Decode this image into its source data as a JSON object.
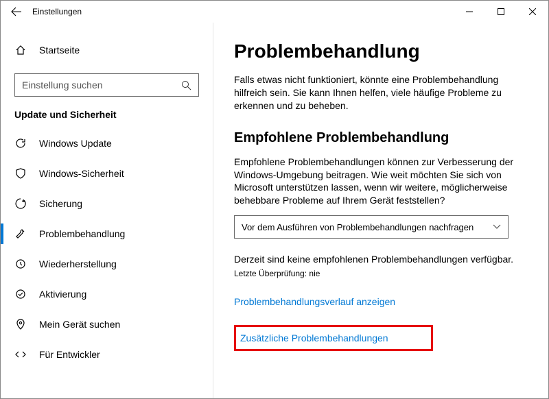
{
  "window": {
    "title": "Einstellungen"
  },
  "sidebar": {
    "home": "Startseite",
    "search_placeholder": "Einstellung suchen",
    "category": "Update und Sicherheit",
    "items": [
      {
        "label": "Windows Update",
        "icon": "update"
      },
      {
        "label": "Windows-Sicherheit",
        "icon": "shield"
      },
      {
        "label": "Sicherung",
        "icon": "backup"
      },
      {
        "label": "Problembehandlung",
        "icon": "wrench",
        "active": true
      },
      {
        "label": "Wiederherstellung",
        "icon": "restore"
      },
      {
        "label": "Aktivierung",
        "icon": "check"
      },
      {
        "label": "Mein Gerät suchen",
        "icon": "find"
      },
      {
        "label": "Für Entwickler",
        "icon": "dev"
      }
    ]
  },
  "main": {
    "heading": "Problembehandlung",
    "intro": "Falls etwas nicht funktioniert, könnte eine Problembehandlung hilfreich sein. Sie kann Ihnen helfen, viele häufige Probleme zu erkennen und zu beheben.",
    "sub_heading": "Empfohlene Problembehandlung",
    "recommended_desc": "Empfohlene Problembehandlungen können zur Verbesserung der Windows-Umgebung beitragen. Wie weit möchten Sie sich von Microsoft unterstützen lassen, wenn wir weitere, möglicherweise behebbare Probleme auf Ihrem Gerät feststellen?",
    "dropdown_value": "Vor dem Ausführen von Problembehandlungen nachfragen",
    "status": "Derzeit sind keine empfohlenen Problembehandlungen verfügbar.",
    "last_check": "Letzte Überprüfung: nie",
    "history_link": "Problembehandlungsverlauf anzeigen",
    "additional_link": "Zusätzliche Problembehandlungen"
  }
}
